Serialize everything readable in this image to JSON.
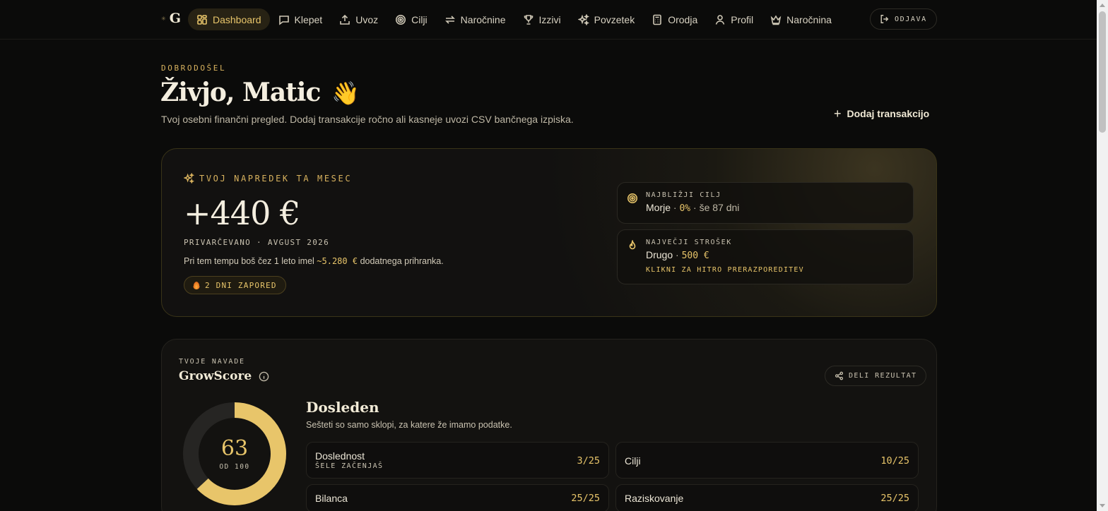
{
  "nav": {
    "logo_text": "G",
    "items": [
      {
        "label": "Dashboard",
        "icon": "grid-icon",
        "active": true
      },
      {
        "label": "Klepet",
        "icon": "chat-icon"
      },
      {
        "label": "Uvoz",
        "icon": "upload-icon"
      },
      {
        "label": "Cilji",
        "icon": "target-icon"
      },
      {
        "label": "Naročnine",
        "icon": "repeat-icon"
      },
      {
        "label": "Izzivi",
        "icon": "trophy-icon"
      },
      {
        "label": "Povzetek",
        "icon": "sparkles-icon"
      },
      {
        "label": "Orodja",
        "icon": "calculator-icon"
      },
      {
        "label": "Profil",
        "icon": "user-icon"
      },
      {
        "label": "Naročnina",
        "icon": "crown-icon"
      }
    ],
    "logout_label": "ODJAVA"
  },
  "header": {
    "eyebrow": "DOBRODOŠEL",
    "greeting": "Živjo, Matic",
    "wave_emoji": "👋",
    "subtitle": "Tvoj osebni finančni pregled. Dodaj transakcije ročno ali kasneje uvozi CSV bančnega izpiska.",
    "add_button": "Dodaj transakcijo"
  },
  "progress": {
    "label": "TVOJ NAPREDEK TA MESEC",
    "amount": "+440 €",
    "saved_label": "PRIVARČEVANO · AVGUST 2026",
    "projection_prefix": "Pri tem tempu boš čez 1 leto imel",
    "projection_value": "~5.280 €",
    "projection_suffix": "dodatnega prihranka.",
    "streak": "2 DNI ZAPORED",
    "nearest_goal": {
      "label": "NAJBLIŽJI CILJ",
      "name": "Morje",
      "percent": "0%",
      "remaining": "še 87 dni"
    },
    "biggest_expense": {
      "label": "NAJVEČJI STROŠEK",
      "category": "Drugo",
      "amount": "500 €",
      "action": "KLIKNI ZA HITRO PRERAZPOREDITEV"
    }
  },
  "growscore": {
    "eyebrow": "TVOJE NAVADE",
    "title": "GrowScore",
    "share_label": "DELI REZULTAT",
    "score": "63",
    "score_value": 63,
    "score_max": 100,
    "score_of": "OD 100",
    "level": "Dosleden",
    "description": "Sešteti so samo sklopi, za katere že imamo podatke.",
    "metrics": [
      {
        "name": "Doslednost",
        "sub": "ŠELE ZAČENJAŠ",
        "score": "3/25"
      },
      {
        "name": "Cilji",
        "score": "10/25"
      },
      {
        "name": "Bilanca",
        "score": "25/25"
      },
      {
        "name": "Raziskovanje",
        "score": "25/25"
      }
    ]
  },
  "colors": {
    "accent": "#e8c56a",
    "background": "#0b0b0a",
    "card": "#131210"
  }
}
